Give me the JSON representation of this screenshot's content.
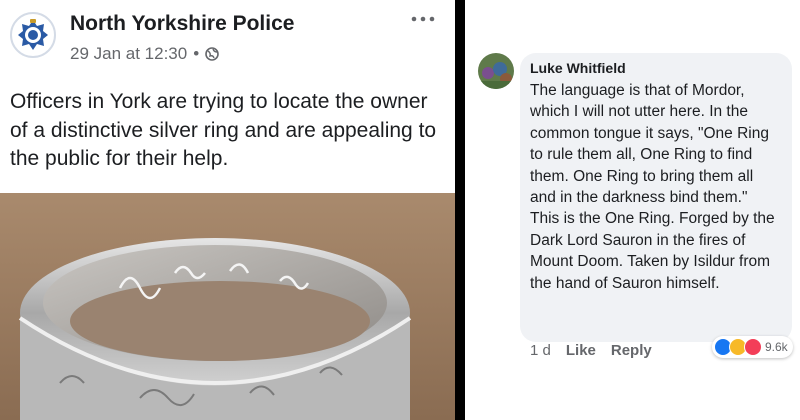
{
  "post": {
    "page_name": "North Yorkshire Police",
    "timestamp": "29 Jan at 12:30",
    "separator": "•",
    "body": "Officers in York are trying to locate the owner of a distinctive silver ring and are appealing to the public for their help.",
    "more_icon": "ellipsis-icon",
    "privacy_icon": "globe-icon"
  },
  "comment": {
    "author": "Luke Whitfield",
    "text": "The language is that of Mordor, which I will not utter here. In the common tongue it says, \"One Ring to rule them all, One Ring to find them. One Ring to bring them all and in the darkness bind them.\"\nThis is the One Ring. Forged by the Dark Lord Sauron in the fires of Mount Doom. Taken by Isildur from the hand of Sauron himself.",
    "age": "1 d",
    "like_label": "Like",
    "reply_label": "Reply",
    "reaction_count": "9.6k",
    "reaction_icons": [
      "like-icon",
      "haha-icon",
      "love-icon"
    ]
  },
  "colors": {
    "like": "#1877f2",
    "haha": "#f7b928",
    "love": "#f33e58",
    "muted": "#65676b",
    "bubble": "#f0f2f5"
  }
}
